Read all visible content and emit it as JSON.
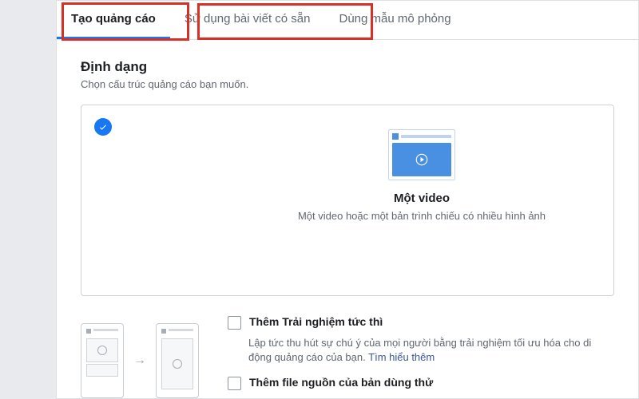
{
  "tabs": {
    "create": "Tạo quảng cáo",
    "existing": "Sử dụng bài viết có sẵn",
    "mockup": "Dùng mẫu mô phỏng"
  },
  "format": {
    "heading": "Định dạng",
    "sub": "Chọn cấu trúc quảng cáo bạn muốn.",
    "video": {
      "title": "Một video",
      "desc": "Một video hoặc một bản trình chiếu có nhiều hình ảnh"
    }
  },
  "instant": {
    "title": "Thêm Trải nghiệm tức thì",
    "desc": "Lập tức thu hút sự chú ý của mọi người bằng trải nghiệm tối ưu hóa cho di động quảng cáo của bạn.",
    "link": "Tìm hiểu thêm"
  },
  "trial": {
    "title": "Thêm file nguồn của bản dùng thử"
  }
}
